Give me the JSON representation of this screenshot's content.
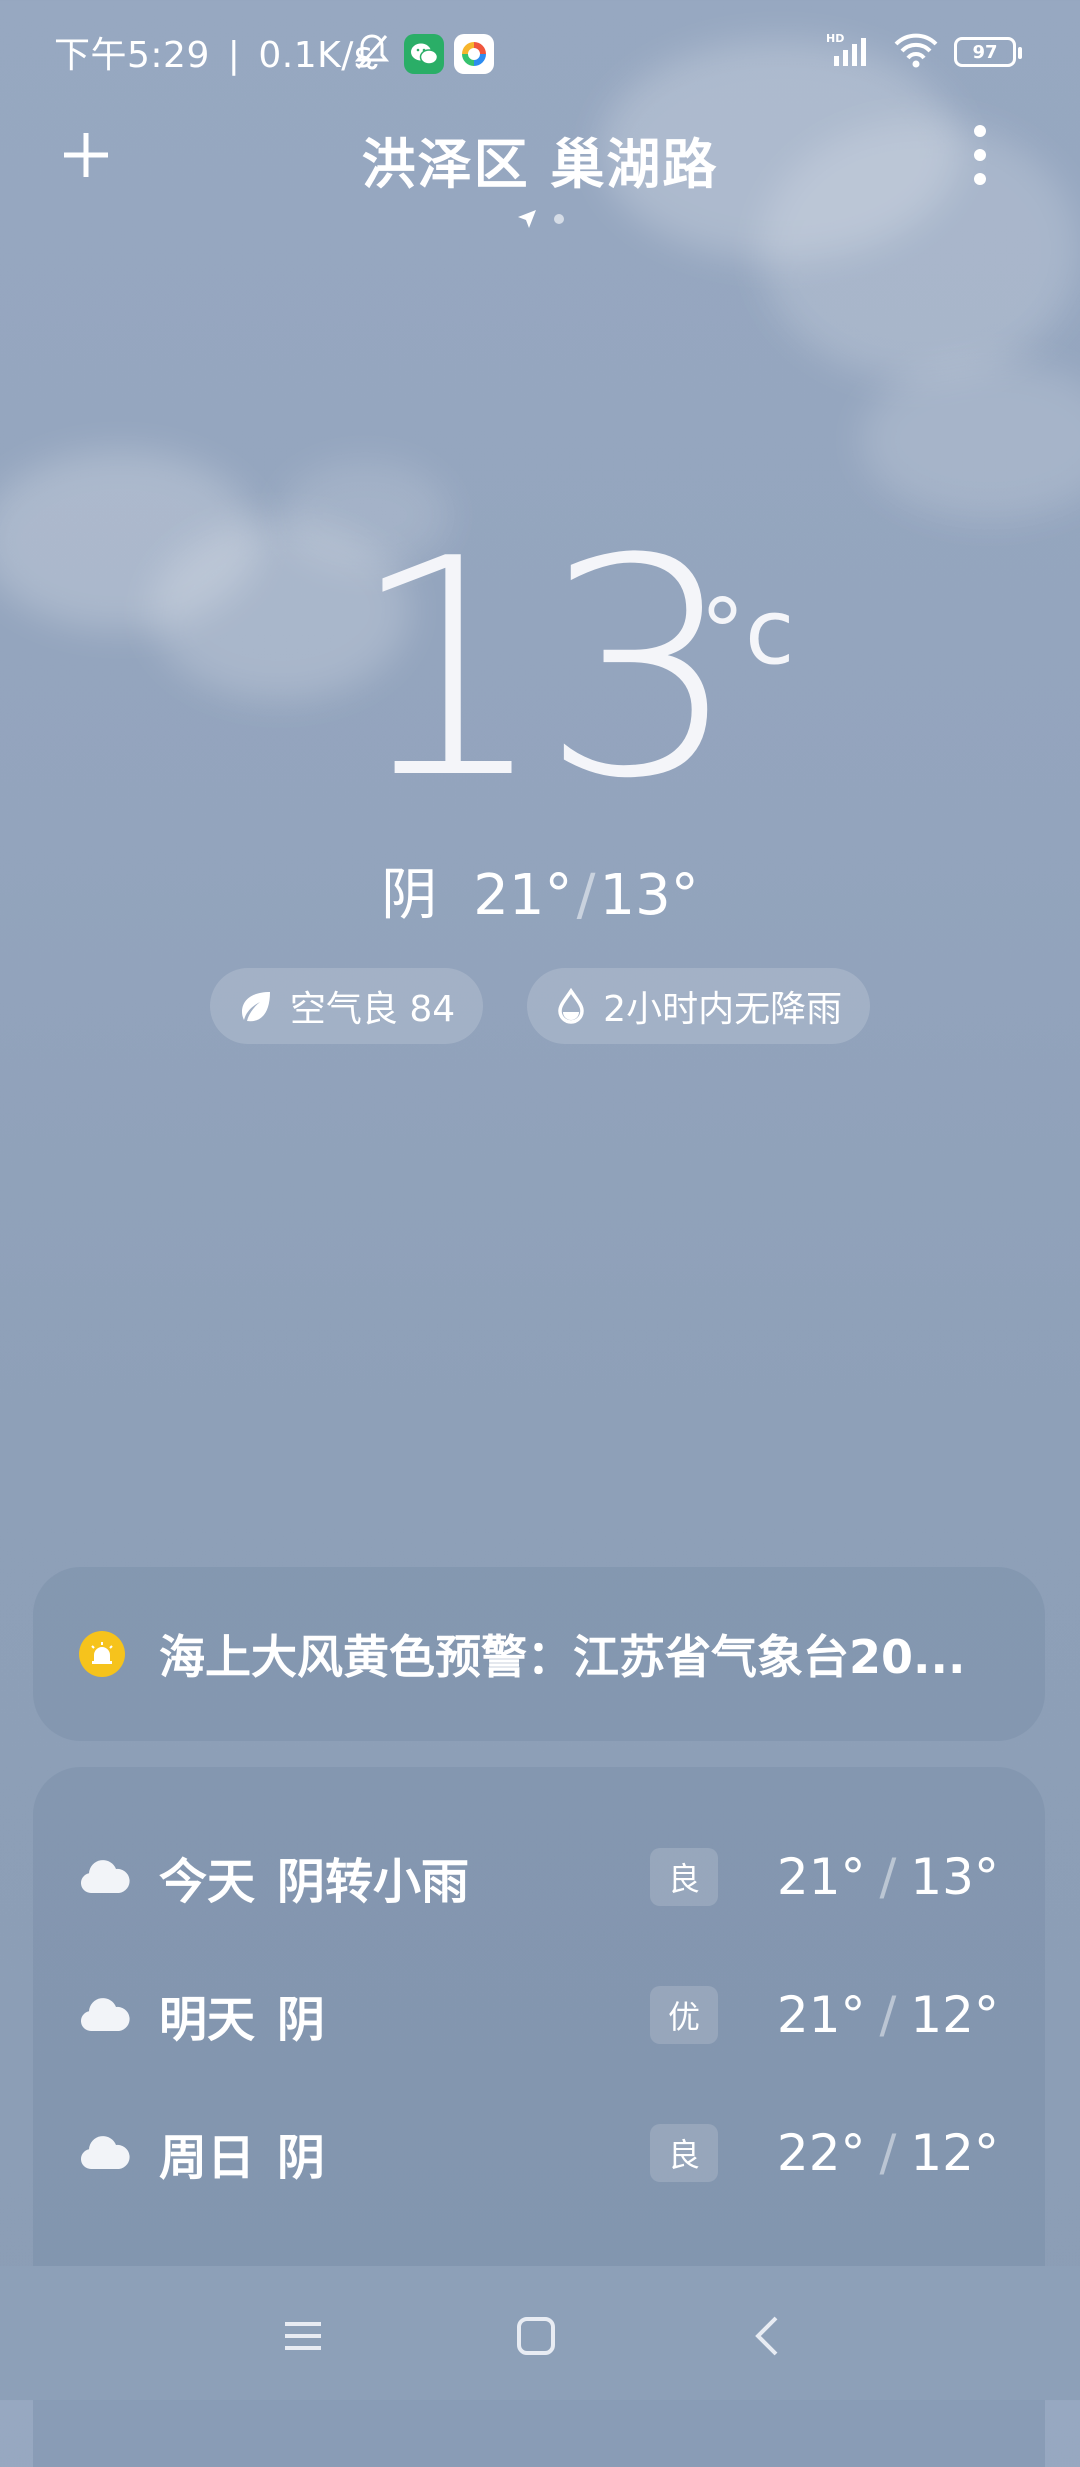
{
  "status_bar": {
    "time": "下午5:29",
    "separator": "|",
    "network_speed": "0.1K/s",
    "battery": "97",
    "icons": [
      "mute-bell-icon",
      "wechat-icon",
      "app-icon",
      "hd-signal-icon",
      "wifi-icon",
      "battery-icon"
    ]
  },
  "header": {
    "location": "洪泽区 巢湖路",
    "add_icon": "plus-icon",
    "menu_icon": "more-vertical-icon"
  },
  "current": {
    "temperature": "13",
    "unit": "°c",
    "condition": "阴",
    "high": "21°",
    "slash": "/",
    "low": "13°"
  },
  "pills": {
    "air_quality": "空气良 84",
    "rain": "2小时内无降雨"
  },
  "alert": {
    "text": "海上大风黄色预警：江苏省气象台20...",
    "color": "#f6c31c"
  },
  "forecast": [
    {
      "day": "今天",
      "condition": "阴转小雨",
      "aqi": "良",
      "high": "21°",
      "low": "13°"
    },
    {
      "day": "明天",
      "condition": "阴",
      "aqi": "优",
      "high": "21°",
      "low": "12°"
    },
    {
      "day": "周日",
      "condition": "阴",
      "aqi": "良",
      "high": "22°",
      "low": "12°"
    }
  ],
  "forecast_slash": "/",
  "nav": {
    "icons": [
      "menu-icon",
      "home-icon",
      "back-icon"
    ]
  }
}
